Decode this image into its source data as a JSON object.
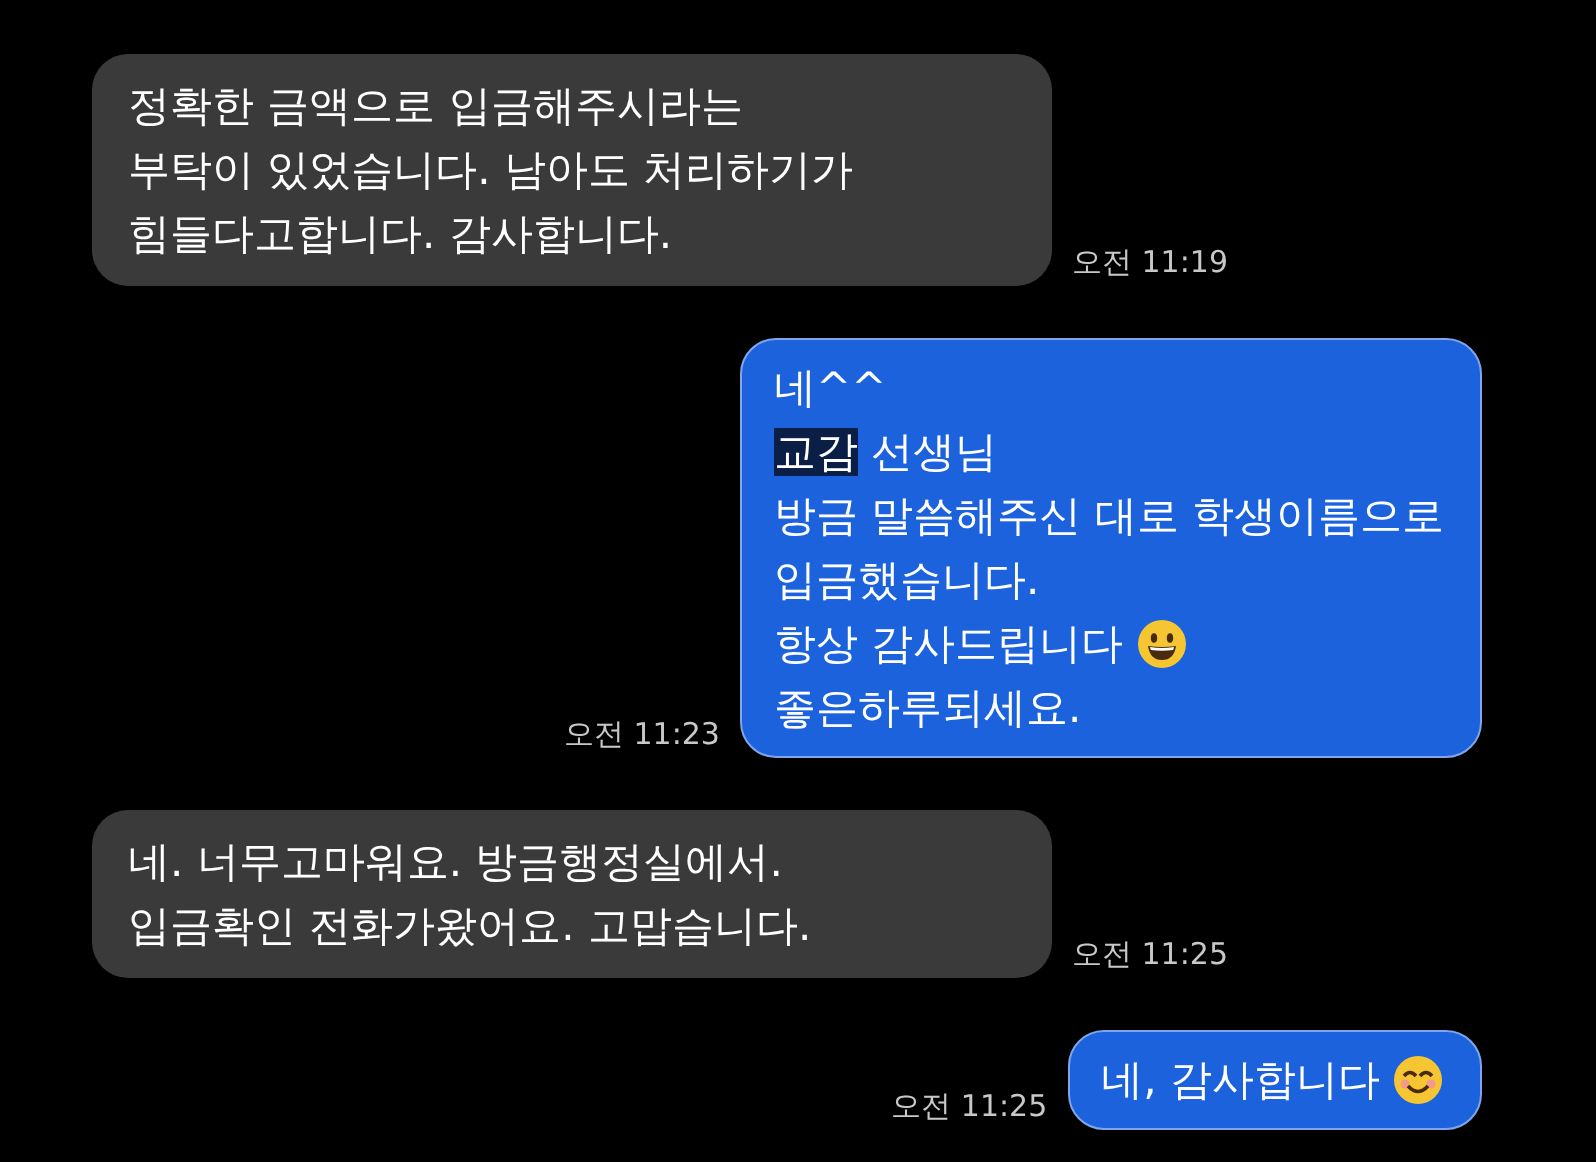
{
  "messages": [
    {
      "kind": "incoming",
      "time": "오전 11:19",
      "lines": [
        {
          "kind": "text",
          "parts": [
            {
              "text": "정확한 금액으로 입금해주시라는",
              "highlighted": false
            }
          ]
        },
        {
          "kind": "text",
          "parts": [
            {
              "text": "부탁이 있었습니다. 남아도 처리하기가",
              "highlighted": false
            }
          ]
        },
        {
          "kind": "text",
          "parts": [
            {
              "text": "힘들다고합니다. 감사합니다.",
              "highlighted": false
            }
          ]
        }
      ]
    },
    {
      "kind": "outgoing",
      "time": "오전 11:23",
      "lines": [
        {
          "kind": "text",
          "parts": [
            {
              "text": "네^^",
              "highlighted": false
            }
          ]
        },
        {
          "kind": "text",
          "parts": [
            {
              "text": "교감",
              "highlighted": true
            },
            {
              "text": " 선생님",
              "highlighted": false
            }
          ]
        },
        {
          "kind": "text",
          "parts": [
            {
              "text": "방금 말씀해주신 대로 학생이름으로",
              "highlighted": false
            }
          ]
        },
        {
          "kind": "text",
          "parts": [
            {
              "text": "입금했습니다.",
              "highlighted": false
            }
          ]
        },
        {
          "kind": "grinning",
          "parts": [
            {
              "text": "항상 감사드립니다",
              "highlighted": false
            }
          ]
        },
        {
          "kind": "text",
          "parts": [
            {
              "text": "좋은하루되세요.",
              "highlighted": false
            }
          ]
        }
      ]
    },
    {
      "kind": "incoming",
      "time": "오전 11:25",
      "lines": [
        {
          "kind": "text",
          "parts": [
            {
              "text": "네. 너무고마워요. 방금행정실에서.",
              "highlighted": false
            }
          ]
        },
        {
          "kind": "text",
          "parts": [
            {
              "text": "입금확인 전화가왔어요. 고맙습니다.",
              "highlighted": false
            }
          ]
        }
      ]
    },
    {
      "kind": "outgoing",
      "time": "오전 11:25",
      "lines": [
        {
          "kind": "smiling",
          "parts": [
            {
              "text": "네, 감사합니다",
              "highlighted": false
            }
          ]
        }
      ]
    }
  ]
}
